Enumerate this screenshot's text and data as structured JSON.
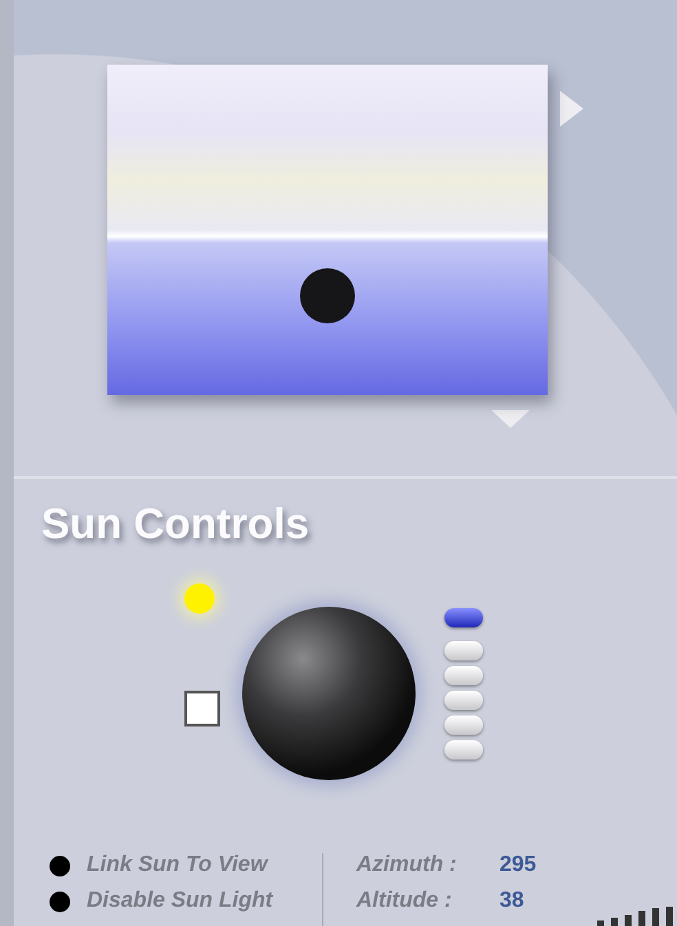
{
  "preview": {
    "sun_visible": true
  },
  "title": "Sun Controls",
  "sun_light": {
    "on": true
  },
  "color_swatch": {
    "color": "#ffffff"
  },
  "steps": [
    {
      "selected": true
    },
    {
      "selected": false
    },
    {
      "selected": false
    },
    {
      "selected": false
    },
    {
      "selected": false
    },
    {
      "selected": false
    }
  ],
  "options": [
    {
      "label": "Link Sun To View",
      "checked": true
    },
    {
      "label": "Disable Sun Light",
      "checked": true
    }
  ],
  "readings": [
    {
      "label": "Azimuth :",
      "value": "295"
    },
    {
      "label": "Altitude :",
      "value": "38"
    }
  ]
}
